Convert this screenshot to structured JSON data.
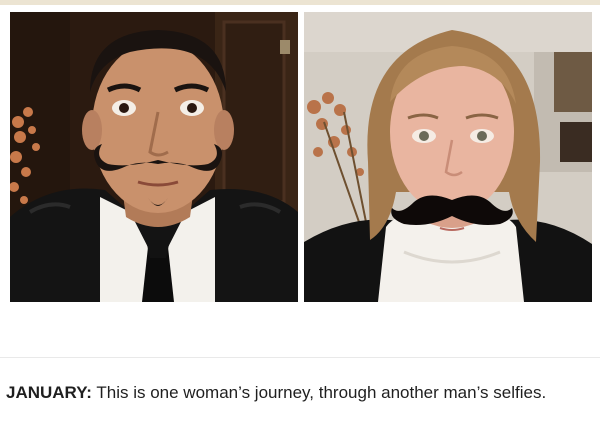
{
  "caption": {
    "lead": "JANUARY:",
    "text": "This is one woman’s journey, through another man’s selfies."
  },
  "photos": [
    {
      "subject": "man",
      "palette": {
        "background": "#2a1a0f",
        "skin": "#c9916c",
        "hair": "#1a1310",
        "jacket": "#141414",
        "shirt": "#f3f1ec",
        "tie": "#0c0c0c"
      }
    },
    {
      "subject": "woman",
      "palette": {
        "background": "#cfc9c0",
        "skin": "#e9b5a0",
        "hair": "#a47a4d",
        "jacket": "#121212",
        "scarf": "#f4f1ec",
        "mustache": "#0e0908"
      }
    }
  ]
}
